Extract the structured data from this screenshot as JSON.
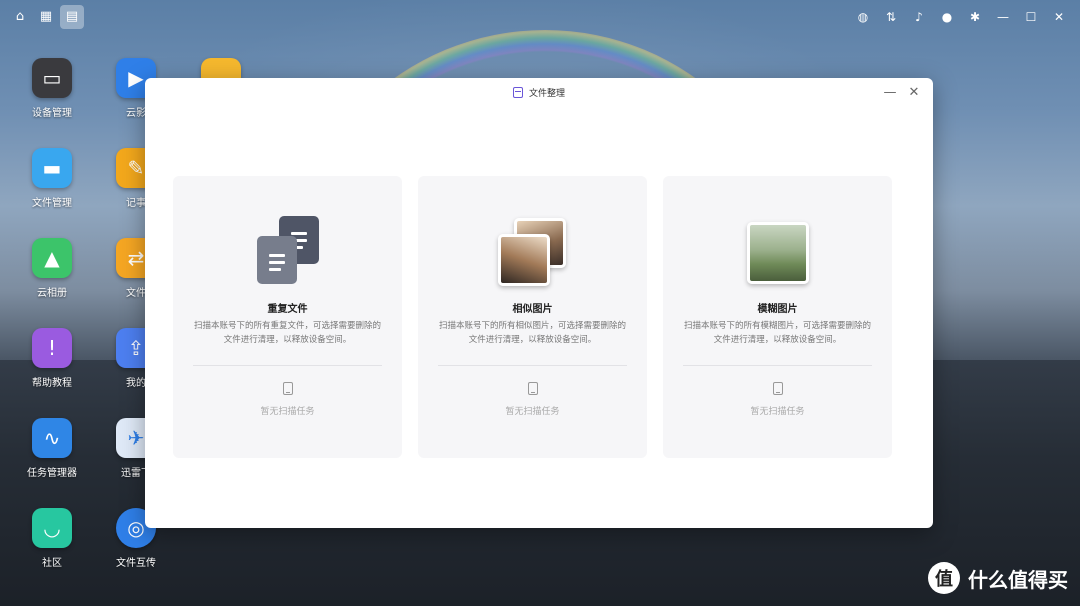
{
  "topbar": {
    "left_icons": [
      "home-icon",
      "apps-grid-icon",
      "file-organize-icon"
    ],
    "right_icons": [
      "globe-icon",
      "sync-icon",
      "bell-icon",
      "user-icon",
      "settings-icon",
      "minimize-icon",
      "maximize-icon",
      "close-icon"
    ]
  },
  "desktop": {
    "icons": [
      {
        "label": "设备管理",
        "icon": "device-icon"
      },
      {
        "label": "文件管理",
        "icon": "folder-icon"
      },
      {
        "label": "云相册",
        "icon": "photo-album-icon"
      },
      {
        "label": "帮助教程",
        "icon": "help-icon"
      },
      {
        "label": "任务管理器",
        "icon": "task-manager-icon"
      },
      {
        "label": "社区",
        "icon": "community-icon"
      },
      {
        "label": "云影院",
        "icon": "video-icon"
      },
      {
        "label": "记事本",
        "icon": "notes-icon"
      },
      {
        "label": "文件同步",
        "icon": "sync-icon"
      },
      {
        "label": "我的备份",
        "icon": "backup-icon"
      },
      {
        "label": "迅雷下载",
        "icon": "thunder-icon"
      },
      {
        "label": "文件互传",
        "icon": "airdrop-icon"
      }
    ],
    "truncated_labels": [
      "云影",
      "记事",
      "文件",
      "我的",
      "迅雷下"
    ]
  },
  "window": {
    "title": "文件整理",
    "cards": [
      {
        "title": "重复文件",
        "desc": "扫描本账号下的所有重复文件，可选择需要删除的文件进行清理，以释放设备空间。",
        "empty": "暂无扫描任务"
      },
      {
        "title": "相似图片",
        "desc": "扫描本账号下的所有相似图片，可选择需要删除的文件进行清理，以释放设备空间。",
        "empty": "暂无扫描任务"
      },
      {
        "title": "模糊图片",
        "desc": "扫描本账号下的所有模糊图片，可选择需要删除的文件进行清理，以释放设备空间。",
        "empty": "暂无扫描任务"
      }
    ]
  },
  "watermark": {
    "logo": "值",
    "text": "什么值得买"
  }
}
